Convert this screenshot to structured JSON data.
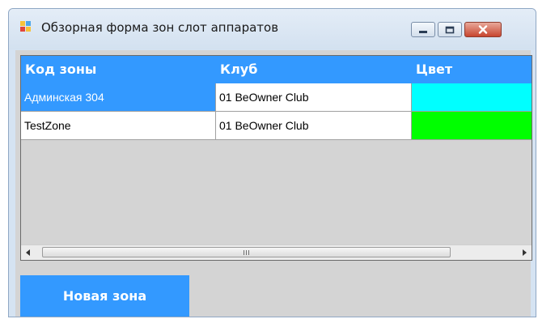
{
  "window": {
    "title": "Обзорная форма зон слот аппаратов"
  },
  "grid": {
    "columns": [
      {
        "label": "Код зоны"
      },
      {
        "label": "Клуб"
      },
      {
        "label": "Цвет"
      }
    ],
    "rows": [
      {
        "code": "Админская 304",
        "club": "01 BeOwner Club",
        "color": "#00ffff",
        "selected": true
      },
      {
        "code": "TestZone",
        "club": "01 BeOwner Club",
        "color": "#00ff00",
        "selected": false
      }
    ]
  },
  "scrollbar": {
    "thumb_grip": "III"
  },
  "actions": {
    "new_zone_label": "Новая зона"
  },
  "colors": {
    "accent": "#3399ff",
    "grid_background": "#d4d4d4",
    "selected_row_text": "#ffffff"
  }
}
